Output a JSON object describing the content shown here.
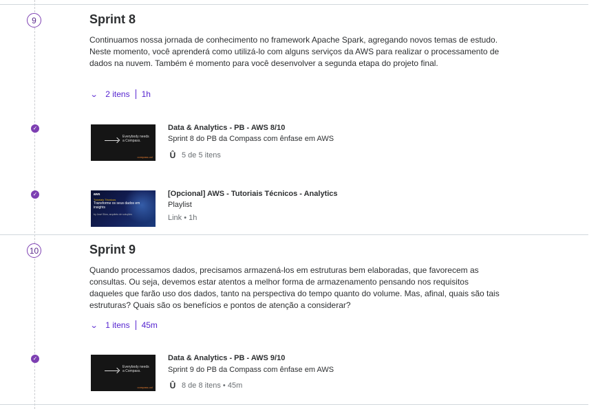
{
  "sections": [
    {
      "step": "9",
      "title": "Sprint 8",
      "description": "Continuamos nossa jornada de conhecimento no framework Apache Spark, agregando novos temas de estudo. Neste momento, você aprenderá como utilizá-lo com alguns serviços da AWS para realizar o processamento de dados na nuvem. Também é momento para você desenvolver a segunda etapa do projeto final.",
      "count": "2 itens",
      "duration": "1h",
      "items": [
        {
          "title": "Data & Analytics - PB - AWS 8/10",
          "subtitle": "Sprint 8 do PB da Compass com ênfase em AWS",
          "meta": "5 de 5 itens",
          "thumb_text": "Everybody needs a Compass.",
          "thumb_logo": "compass.uol"
        },
        {
          "title": "[Opcional] AWS - Tutoriais Técnicos - Analytics",
          "subtitle": "Playlist",
          "meta": "Link • 1h",
          "thumb_logo": "aws",
          "thumb_small": "Tutoriais Técnicos",
          "thumb_big": "Transforme os seus dados em insights",
          "thumb_author": "by José Silva, arquiteto de soluções"
        }
      ]
    },
    {
      "step": "10",
      "title": "Sprint 9",
      "description": "Quando processamos dados, precisamos armazená-los em estruturas bem elaboradas, que favorecem as consultas. Ou seja, devemos estar atentos a melhor forma de armazenamento pensando nos requisitos daqueles que farão uso dos dados, tanto na perspectiva do tempo quanto do volume. Mas, afinal, quais são tais estruturas? Quais são os benefícios e pontos de atenção a considerar?",
      "count": "1 itens",
      "duration": "45m",
      "items": [
        {
          "title": "Data & Analytics - PB - AWS 9/10",
          "subtitle": "Sprint 9 do PB da Compass com ênfase em AWS",
          "meta": "8 de 8 itens • 45m",
          "thumb_text": "Everybody needs a Compass.",
          "thumb_logo": "compass.uol"
        }
      ]
    }
  ],
  "colors": {
    "accent": "#5624d0",
    "check": "#7d3fb2",
    "divider": "#d1d7dc"
  },
  "icons": {
    "check": "check-circle-icon",
    "expand": "chevron-down-icon",
    "course": "udemy-u-icon"
  }
}
